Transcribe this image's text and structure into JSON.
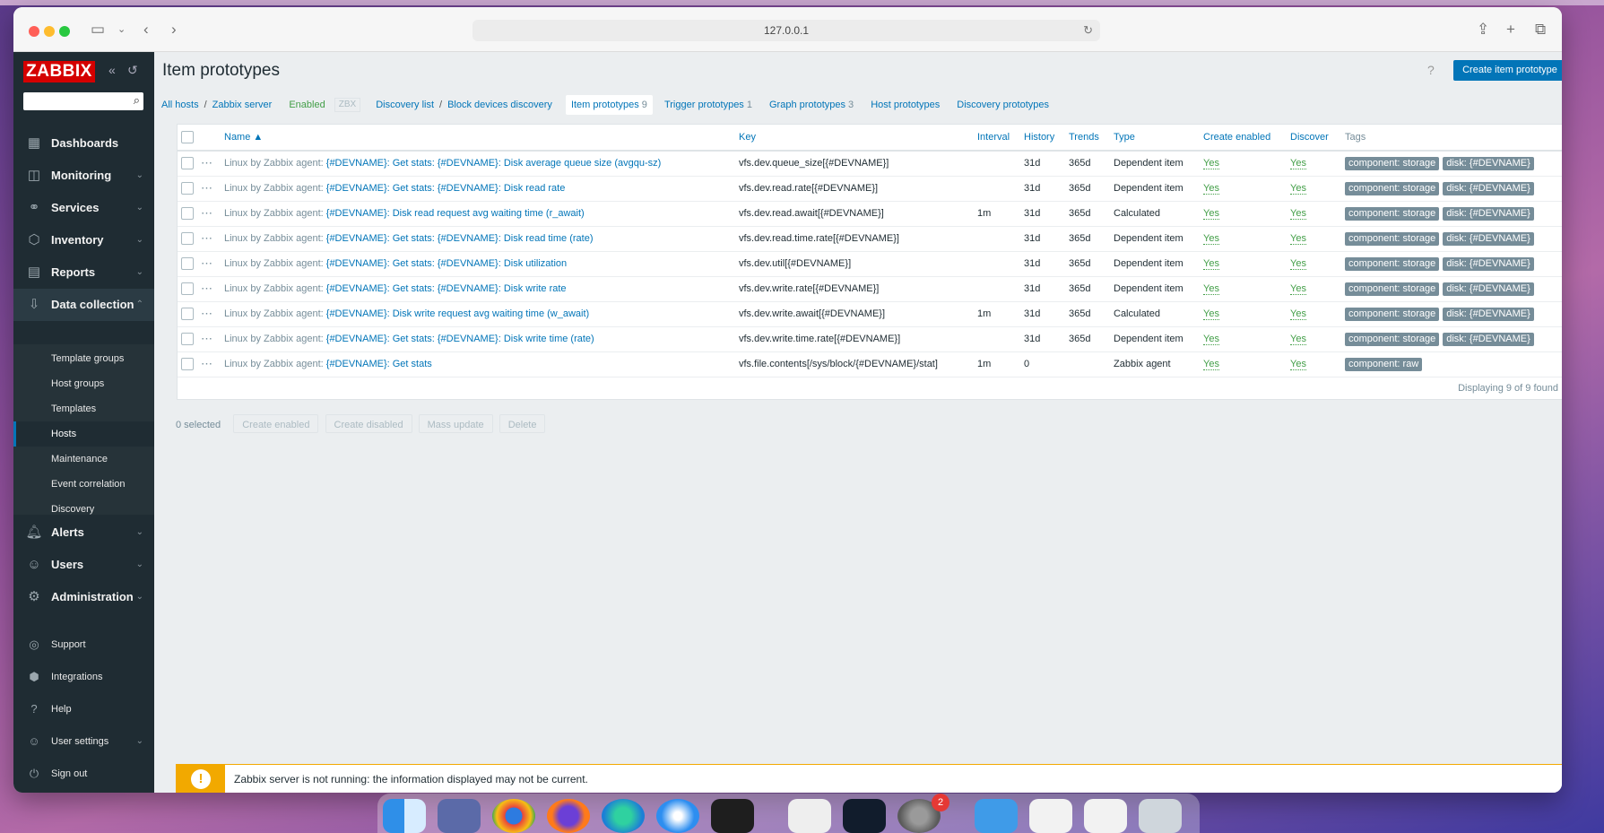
{
  "browser": {
    "url": "127.0.0.1"
  },
  "sidebar": {
    "logo": "ZABBIX",
    "nav": [
      {
        "label": "Dashboards",
        "icon": "dashboard-icon"
      },
      {
        "label": "Monitoring",
        "icon": "monitoring-icon"
      },
      {
        "label": "Services",
        "icon": "services-icon"
      },
      {
        "label": "Inventory",
        "icon": "inventory-icon"
      },
      {
        "label": "Reports",
        "icon": "reports-icon"
      },
      {
        "label": "Data collection",
        "icon": "data-collection-icon"
      },
      {
        "label": "Alerts",
        "icon": "alerts-icon"
      },
      {
        "label": "Users",
        "icon": "users-icon"
      },
      {
        "label": "Administration",
        "icon": "administration-icon"
      }
    ],
    "submenu": [
      "Template groups",
      "Host groups",
      "Templates",
      "Hosts",
      "Maintenance",
      "Event correlation",
      "Discovery"
    ],
    "footer": [
      "Support",
      "Integrations",
      "Help",
      "User settings",
      "Sign out"
    ]
  },
  "page": {
    "title": "Item prototypes",
    "help": "?",
    "create_button": "Create item prototype"
  },
  "breadcrumbs": {
    "all_hosts": "All hosts",
    "host": "Zabbix server",
    "status": "Enabled",
    "zbx": "ZBX",
    "discovery_list": "Discovery list",
    "discovery_rule": "Block devices discovery",
    "tabs": [
      {
        "label": "Item prototypes",
        "count": "9"
      },
      {
        "label": "Trigger prototypes",
        "count": "1"
      },
      {
        "label": "Graph prototypes",
        "count": "3"
      },
      {
        "label": "Host prototypes",
        "count": ""
      },
      {
        "label": "Discovery prototypes",
        "count": ""
      }
    ]
  },
  "table": {
    "columns": [
      "Name ▲",
      "Key",
      "Interval",
      "History",
      "Trends",
      "Type",
      "Create enabled",
      "Discover",
      "Tags"
    ],
    "template_prefix": "Linux by Zabbix agent",
    "rows": [
      {
        "name": "{#DEVNAME}: Get stats: {#DEVNAME}: Disk average queue size (avgqu-sz)",
        "key": "vfs.dev.queue_size[{#DEVNAME}]",
        "interval": "",
        "history": "31d",
        "trends": "365d",
        "type": "Dependent item",
        "create_enabled": "Yes",
        "discover": "Yes",
        "tags": [
          "component: storage",
          "disk: {#DEVNAME}"
        ]
      },
      {
        "name": "{#DEVNAME}: Get stats: {#DEVNAME}: Disk read rate",
        "key": "vfs.dev.read.rate[{#DEVNAME}]",
        "interval": "",
        "history": "31d",
        "trends": "365d",
        "type": "Dependent item",
        "create_enabled": "Yes",
        "discover": "Yes",
        "tags": [
          "component: storage",
          "disk: {#DEVNAME}"
        ]
      },
      {
        "name": "{#DEVNAME}: Disk read request avg waiting time (r_await)",
        "key": "vfs.dev.read.await[{#DEVNAME}]",
        "interval": "1m",
        "history": "31d",
        "trends": "365d",
        "type": "Calculated",
        "create_enabled": "Yes",
        "discover": "Yes",
        "tags": [
          "component: storage",
          "disk: {#DEVNAME}"
        ]
      },
      {
        "name": "{#DEVNAME}: Get stats: {#DEVNAME}: Disk read time (rate)",
        "key": "vfs.dev.read.time.rate[{#DEVNAME}]",
        "interval": "",
        "history": "31d",
        "trends": "365d",
        "type": "Dependent item",
        "create_enabled": "Yes",
        "discover": "Yes",
        "tags": [
          "component: storage",
          "disk: {#DEVNAME}"
        ]
      },
      {
        "name": "{#DEVNAME}: Get stats: {#DEVNAME}: Disk utilization",
        "key": "vfs.dev.util[{#DEVNAME}]",
        "interval": "",
        "history": "31d",
        "trends": "365d",
        "type": "Dependent item",
        "create_enabled": "Yes",
        "discover": "Yes",
        "tags": [
          "component: storage",
          "disk: {#DEVNAME}"
        ]
      },
      {
        "name": "{#DEVNAME}: Get stats: {#DEVNAME}: Disk write rate",
        "key": "vfs.dev.write.rate[{#DEVNAME}]",
        "interval": "",
        "history": "31d",
        "trends": "365d",
        "type": "Dependent item",
        "create_enabled": "Yes",
        "discover": "Yes",
        "tags": [
          "component: storage",
          "disk: {#DEVNAME}"
        ]
      },
      {
        "name": "{#DEVNAME}: Disk write request avg waiting time (w_await)",
        "key": "vfs.dev.write.await[{#DEVNAME}]",
        "interval": "1m",
        "history": "31d",
        "trends": "365d",
        "type": "Calculated",
        "create_enabled": "Yes",
        "discover": "Yes",
        "tags": [
          "component: storage",
          "disk: {#DEVNAME}"
        ]
      },
      {
        "name": "{#DEVNAME}: Get stats: {#DEVNAME}: Disk write time (rate)",
        "key": "vfs.dev.write.time.rate[{#DEVNAME}]",
        "interval": "",
        "history": "31d",
        "trends": "365d",
        "type": "Dependent item",
        "create_enabled": "Yes",
        "discover": "Yes",
        "tags": [
          "component: storage",
          "disk: {#DEVNAME}"
        ]
      },
      {
        "name": "{#DEVNAME}: Get stats",
        "key": "vfs.file.contents[/sys/block/{#DEVNAME}/stat]",
        "interval": "1m",
        "history": "0",
        "trends": "",
        "type": "Zabbix agent",
        "create_enabled": "Yes",
        "discover": "Yes",
        "tags": [
          "component: raw"
        ]
      }
    ],
    "footer": "Displaying 9 of 9 found"
  },
  "actions": {
    "selected": "0 selected",
    "buttons": [
      "Create enabled",
      "Create disabled",
      "Mass update",
      "Delete"
    ]
  },
  "warning": {
    "text": "Zabbix server is not running: the information displayed may not be current."
  },
  "dock": {
    "badge": "2"
  },
  "colors": {
    "accent": "#0275b8",
    "sidebar": "#1f2c33",
    "enabled": "#429e47",
    "warning": "#f2a900",
    "logo": "#d40000"
  }
}
